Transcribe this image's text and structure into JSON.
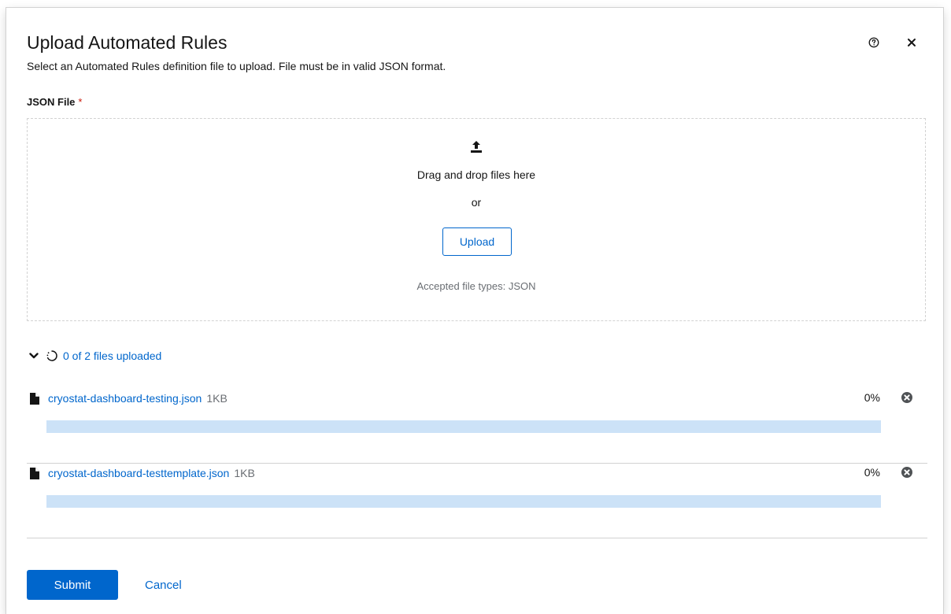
{
  "modal": {
    "title": "Upload Automated Rules",
    "description": "Select an Automated Rules definition file to upload. File must be in valid JSON format.",
    "help_icon": "help-circle-icon",
    "close_icon": "close-icon"
  },
  "form": {
    "label": "JSON File",
    "required_mark": "*"
  },
  "dropzone": {
    "icon": "upload-icon",
    "title": "Drag and drop files here",
    "or": "or",
    "upload_label": "Upload",
    "accepted": "Accepted file types: JSON"
  },
  "status": {
    "text": "0 of 2 files uploaded",
    "expanded": true
  },
  "files": [
    {
      "name": "cryostat-dashboard-testing.json",
      "size": "1KB",
      "percent_label": "0%",
      "progress": 0
    },
    {
      "name": "cryostat-dashboard-testtemplate.json",
      "size": "1KB",
      "percent_label": "0%",
      "progress": 0
    }
  ],
  "actions": {
    "submit_label": "Submit",
    "cancel_label": "Cancel"
  },
  "colors": {
    "primary": "#0066cc",
    "progress_track": "#cce2f7",
    "required": "#c9190b",
    "border": "#d2d2d2",
    "muted_text": "#6a6e73"
  }
}
